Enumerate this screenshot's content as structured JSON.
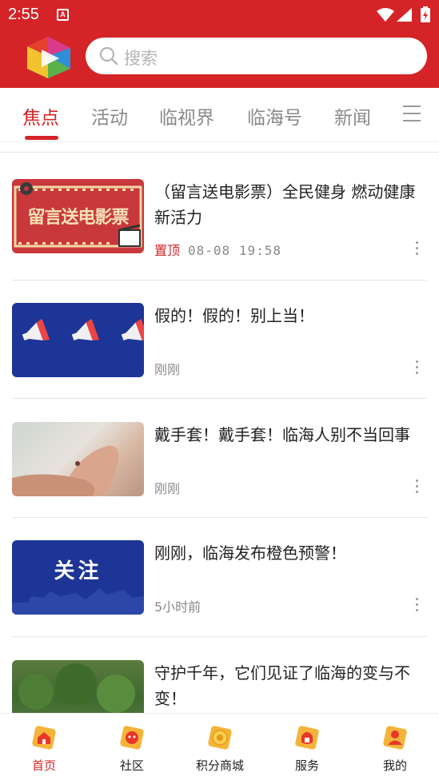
{
  "status_bar": {
    "time": "2:55",
    "notification_badge": "A"
  },
  "search": {
    "placeholder": "搜索"
  },
  "tabs": [
    {
      "label": "焦点",
      "active": true
    },
    {
      "label": "活动",
      "active": false
    },
    {
      "label": "临视界",
      "active": false
    },
    {
      "label": "临海号",
      "active": false
    },
    {
      "label": "新闻",
      "active": false
    }
  ],
  "articles": [
    {
      "title": "（留言送电影票）全民健身  燃动健康新活力",
      "pin": "置顶",
      "time": "08-08  19:58",
      "thumb_text": "留言送电影票"
    },
    {
      "title": "假的！假的！别上当！",
      "time": "刚刚"
    },
    {
      "title": "戴手套！戴手套！临海人别不当回事",
      "time": "刚刚"
    },
    {
      "title": "刚刚，临海发布橙色预警！",
      "time": "5小时前",
      "thumb_text": "关注"
    },
    {
      "title": "守护千年，它们见证了临海的变与不变！"
    }
  ],
  "bottom_nav": [
    {
      "label": "首页",
      "icon": "home-icon",
      "active": true
    },
    {
      "label": "社区",
      "icon": "community-icon",
      "active": false
    },
    {
      "label": "积分商城",
      "icon": "points-mall-icon",
      "active": false
    },
    {
      "label": "服务",
      "icon": "service-icon",
      "active": false
    },
    {
      "label": "我的",
      "icon": "profile-icon",
      "active": false
    }
  ],
  "colors": {
    "brand_red": "#d42427",
    "nav_icon_gold": "#f4b43a"
  }
}
